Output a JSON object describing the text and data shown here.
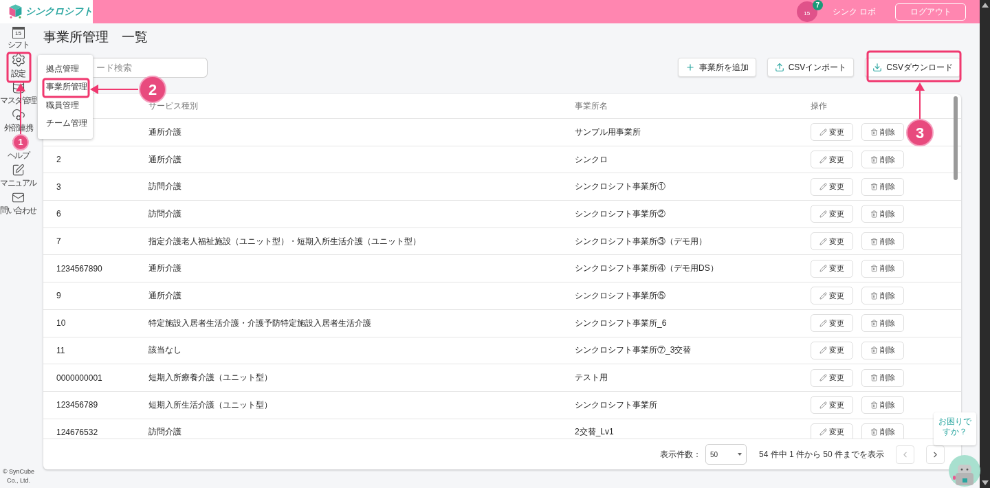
{
  "header": {
    "logo": "シンクロシフト",
    "calendar_day": "15",
    "notification_count": "7",
    "user": "シンク ロボ",
    "logout": "ログアウト"
  },
  "sidebar": {
    "items": [
      {
        "kind": "calendar",
        "label": "シフト",
        "icon_text": "15"
      },
      {
        "kind": "settings",
        "label": "設定"
      },
      {
        "kind": "database",
        "label": "マスタ管理"
      },
      {
        "kind": "cloud",
        "label": "外部連携"
      },
      {
        "kind": "help",
        "label": "ヘルプ"
      },
      {
        "kind": "manual",
        "label": "マニュアル"
      },
      {
        "kind": "mail",
        "label": "問い合わせ"
      }
    ],
    "copyright": "© SynCube Co., Ltd."
  },
  "page_title": "事業所管理　一覧",
  "search": {
    "placeholder": "ード検索"
  },
  "toolbar": [
    {
      "kind": "add",
      "label": "事業所を追加"
    },
    {
      "kind": "import",
      "label": "CSVインポート"
    },
    {
      "kind": "download",
      "label": "CSVダウンロード"
    }
  ],
  "settings_menu": {
    "items": [
      "拠点管理",
      "事業所管理",
      "職員管理",
      "チーム管理"
    ]
  },
  "table": {
    "columns": [
      "サービス種別",
      "事業所名",
      "操作"
    ],
    "rows": [
      {
        "service": "通所介護",
        "name": "サンプル用事業所",
        "actions": [
          "変更",
          "削除"
        ]
      },
      {
        "id": "2",
        "service": "通所介護",
        "name": "シンクロ",
        "actions": [
          "変更",
          "削除"
        ]
      },
      {
        "id": "3",
        "service": "訪問介護",
        "name": "シンクロシフト事業所①",
        "actions": [
          "変更",
          "削除"
        ]
      },
      {
        "id": "6",
        "service": "訪問介護",
        "name": "シンクロシフト事業所②",
        "actions": [
          "変更",
          "削除"
        ]
      },
      {
        "id": "7",
        "service": "指定介護老人福祉施設（ユニット型）・短期入所生活介護（ユニット型）",
        "name": "シンクロシフト事業所③（デモ用）",
        "actions": [
          "変更",
          "削除"
        ]
      },
      {
        "id": "1234567890",
        "service": "通所介護",
        "name": "シンクロシフト事業所④（デモ用DS）",
        "actions": [
          "変更",
          "削除"
        ]
      },
      {
        "id": "9",
        "service": "通所介護",
        "name": "シンクロシフト事業所⑤",
        "actions": [
          "変更",
          "削除"
        ]
      },
      {
        "id": "10",
        "service": "特定施設入居者生活介護・介護予防特定施設入居者生活介護",
        "name": "シンクロシフト事業所_6",
        "actions": [
          "変更",
          "削除"
        ]
      },
      {
        "id": "11",
        "service": "該当なし",
        "name": "シンクロシフト事業所⑦_3交替",
        "actions": [
          "変更",
          "削除"
        ]
      },
      {
        "id": "0000000001",
        "service": "短期入所療養介護（ユニット型）",
        "name": "テスト用",
        "actions": [
          "変更",
          "削除"
        ]
      },
      {
        "id": "123456789",
        "service": "短期入所生活介護（ユニット型）",
        "name": "シンクロシフト事業所",
        "actions": [
          "変更",
          "削除"
        ]
      },
      {
        "id": "124676532",
        "service": "訪問介護",
        "name": "2交替_Lv1",
        "actions": [
          "変更",
          "削除"
        ]
      }
    ]
  },
  "pagination": {
    "per_page_label": "表示件数：",
    "per_page": "50",
    "summary": "54 件中 1 件から 50 件までを表示"
  },
  "help_bubble": "お困りですか？",
  "annotations": [
    {
      "number": "1"
    },
    {
      "number": "2"
    },
    {
      "number": "3"
    }
  ]
}
